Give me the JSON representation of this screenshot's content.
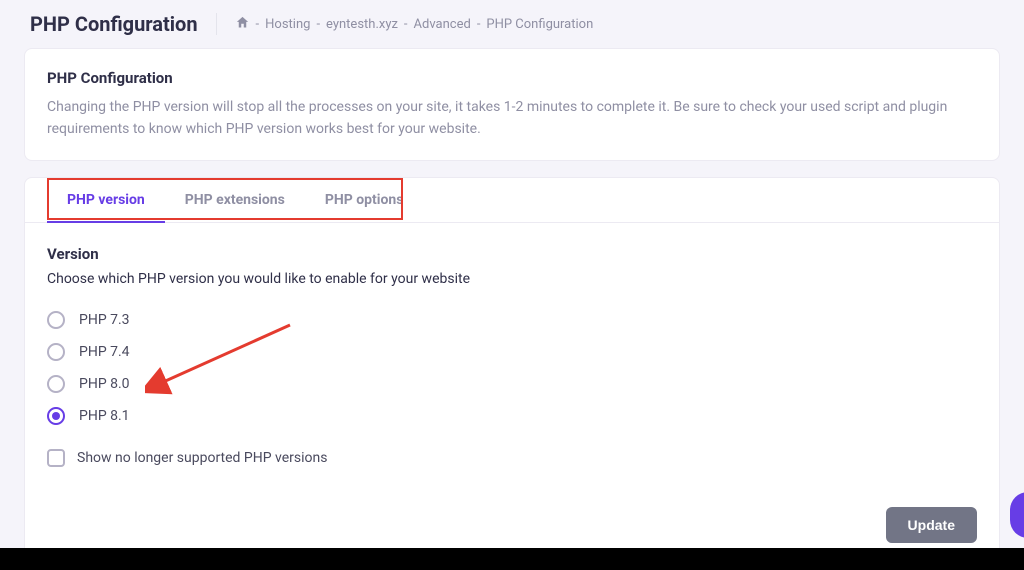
{
  "header": {
    "title": "PHP Configuration",
    "breadcrumb": {
      "sep": "-",
      "item1": "Hosting",
      "item2": "eyntesth.xyz",
      "item3": "Advanced",
      "item4": "PHP Configuration"
    }
  },
  "info_card": {
    "title": "PHP Configuration",
    "desc": "Changing the PHP version will stop all the processes on your site, it takes 1-2 minutes to complete it. Be sure to check your used script and plugin requirements to know which PHP version works best for your website."
  },
  "tabs": {
    "t1": "PHP version",
    "t2": "PHP extensions",
    "t3": "PHP options"
  },
  "version_section": {
    "title": "Version",
    "desc": "Choose which PHP version you would like to enable for your website",
    "options": {
      "o1": "PHP 7.3",
      "o2": "PHP 7.4",
      "o3": "PHP 8.0",
      "o4": "PHP 8.1"
    },
    "selected_index": 3,
    "checkbox_label": "Show no longer supported PHP versions"
  },
  "actions": {
    "update": "Update"
  }
}
